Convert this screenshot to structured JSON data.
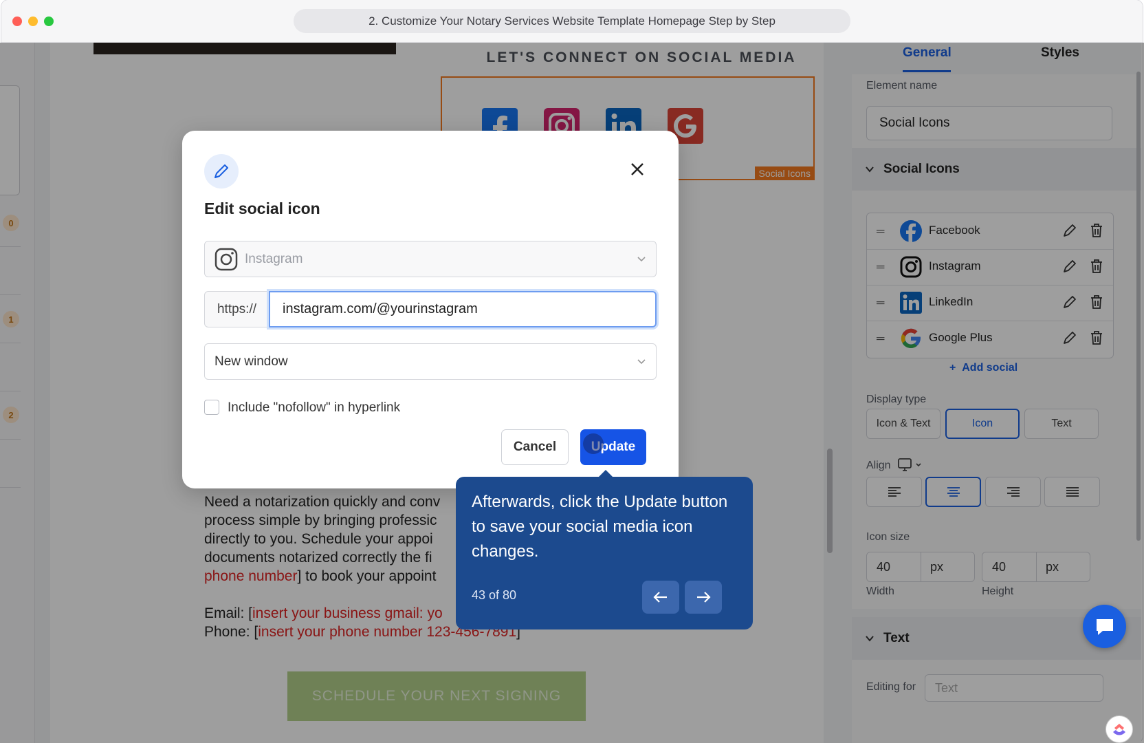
{
  "window": {
    "title": "2. Customize Your Notary Services Website Template Homepage Step by Step",
    "dot_colors": [
      "#ff5f57",
      "#febc2e",
      "#28c840"
    ]
  },
  "left_rail": {
    "badges": [
      "0",
      "1",
      "2"
    ]
  },
  "canvas": {
    "social_heading": "LET'S CONNECT ON SOCIAL MEDIA",
    "social_tag": "Social Icons",
    "body_parts": [
      "Need a notarization quickly and conv",
      "process simple by bringing professic",
      "directly to you. Schedule your appoi",
      "documents notarized correctly the fi",
      "phone number",
      "] to book your appoint"
    ],
    "email_label": "Email: [",
    "email_value": "insert your business gmail: yo",
    "phone_label": "Phone: [",
    "phone_value": "insert your phone number 123-456-7891",
    "phone_close": "]",
    "cta": "SCHEDULE YOUR NEXT SIGNING"
  },
  "panel": {
    "tabs": [
      "General",
      "Styles"
    ],
    "element_name_label": "Element name",
    "element_name_value": "Social Icons",
    "section_social": "Social Icons",
    "socials": [
      "Facebook",
      "Instagram",
      "LinkedIn",
      "Google Plus"
    ],
    "add_social": "Add social",
    "display_type_label": "Display type",
    "display_types": [
      "Icon & Text",
      "Icon",
      "Text"
    ],
    "display_type_selected": "Icon",
    "align_label": "Align",
    "icon_size_label": "Icon size",
    "width_value": "40",
    "height_value": "40",
    "unit": "px",
    "width_label": "Width",
    "height_label": "Height",
    "section_text": "Text",
    "editing_for_label": "Editing for",
    "editing_for_value": "Text"
  },
  "modal": {
    "title": "Edit social icon",
    "platform": "Instagram",
    "prefix": "https://",
    "url_value": "instagram.com/@yourinstagram",
    "target": "New window",
    "nofollow_label": "Include \"nofollow\" in hyperlink",
    "cancel": "Cancel",
    "update": "Update"
  },
  "tooltip": {
    "text": "Afterwards, click the Update button to save your social media icon changes.",
    "counter": "43 of 80"
  },
  "colors": {
    "accent": "#1a5fe0",
    "update_button": "#1654e6",
    "tooltip_bg": "#1c4a8e",
    "highlight_orange": "#f47a1f",
    "cta_green": "#b4d18c"
  }
}
